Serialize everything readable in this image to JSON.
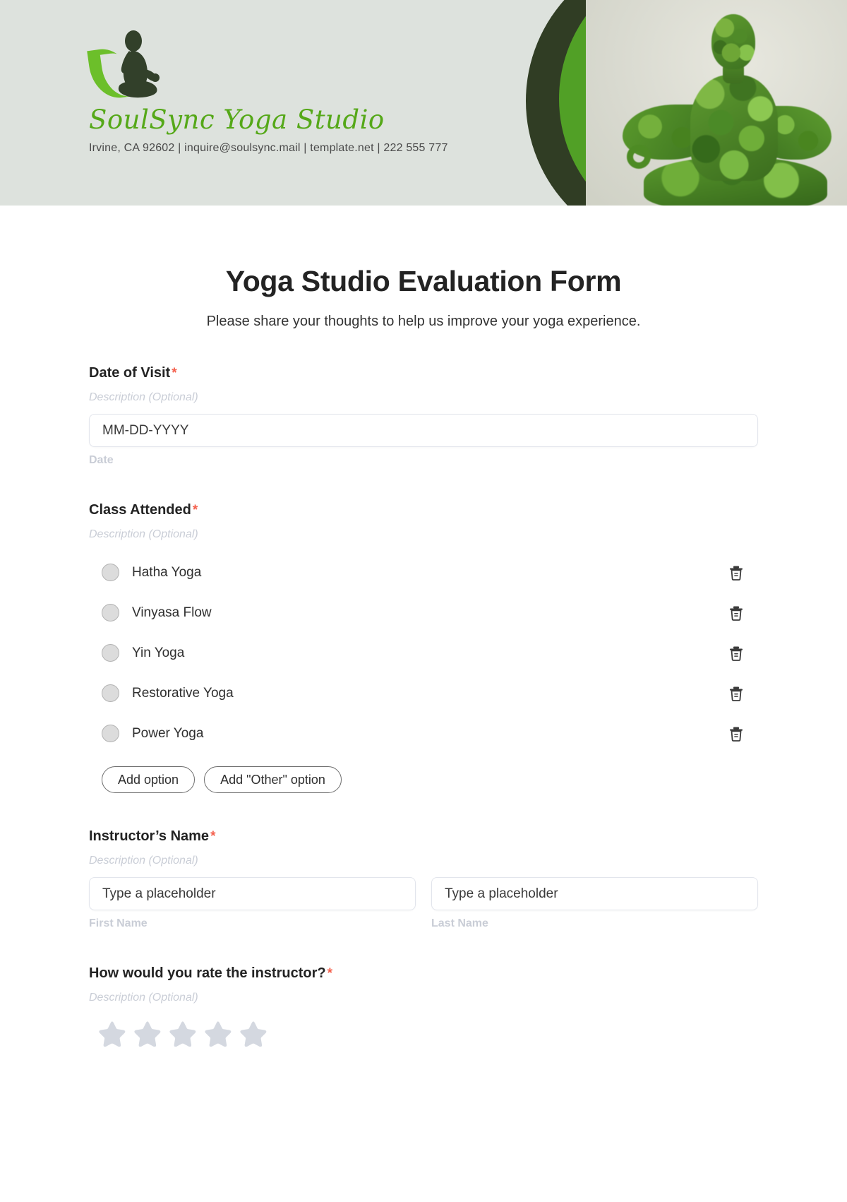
{
  "brand": {
    "studio_name": "SoulSync Yoga Studio",
    "contact_line": "Irvine, CA 92602 | inquire@soulsync.mail | template.net | 222 555 777",
    "logo_icon": "lotus-meditation-leaf-logo",
    "accent_green": "#55a818",
    "header_bg": "#dde2dd",
    "arc_dark": "#303d24",
    "arc_mid": "#51a026",
    "arc_light": "#6cc329"
  },
  "form": {
    "title": "Yoga Studio Evaluation Form",
    "subtitle": "Please share your thoughts to help us improve your yoga experience.",
    "required_marker": "*",
    "description_placeholder": "Description (Optional)"
  },
  "fields": {
    "date_of_visit": {
      "label": "Date of Visit",
      "description": "Description (Optional)",
      "input_value": "MM-DD-YYYY",
      "sub_label": "Date"
    },
    "class_attended": {
      "label": "Class Attended",
      "description": "Description (Optional)",
      "options": [
        {
          "label": "Hatha Yoga",
          "delete_icon": "trash-icon"
        },
        {
          "label": "Vinyasa Flow",
          "delete_icon": "trash-icon"
        },
        {
          "label": "Yin Yoga",
          "delete_icon": "trash-icon"
        },
        {
          "label": "Restorative Yoga",
          "delete_icon": "trash-icon"
        },
        {
          "label": "Power Yoga",
          "delete_icon": "trash-icon"
        }
      ],
      "add_option_label": "Add option",
      "add_other_label": "Add \"Other\" option"
    },
    "instructor_name": {
      "label": "Instructor’s Name",
      "description": "Description (Optional)",
      "first": {
        "placeholder": "Type a placeholder",
        "sub_label": "First Name"
      },
      "last": {
        "placeholder": "Type a placeholder",
        "sub_label": "Last Name"
      }
    },
    "instructor_rating": {
      "label": "How would you rate the instructor?",
      "description": "Description (Optional)",
      "star_count": 5,
      "stars_filled": 0,
      "star_color": "#d4d8e0"
    }
  }
}
